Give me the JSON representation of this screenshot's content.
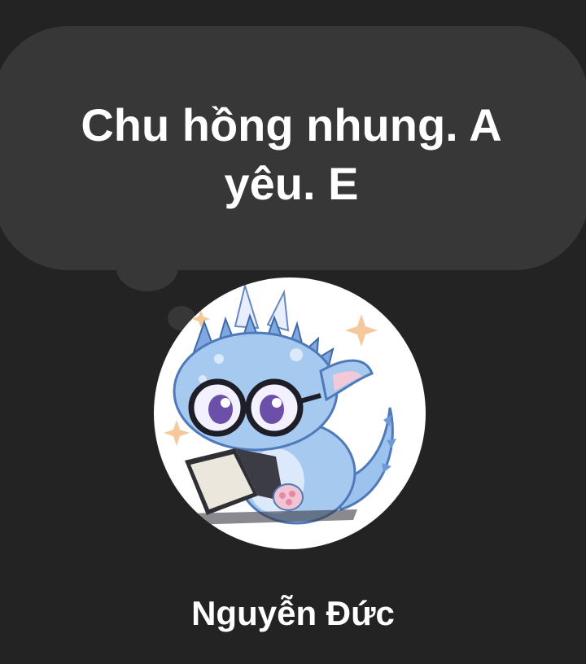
{
  "note": {
    "text": "Chu hồng nhung. A yêu. E"
  },
  "profile": {
    "name": "Nguyễn Đức",
    "avatar_icon": "baby-dragon-reading-book-avatar"
  },
  "colors": {
    "background": "#232323",
    "bubble": "#373737",
    "text": "#ffffff",
    "dragon_blue": "#8fbbea"
  }
}
